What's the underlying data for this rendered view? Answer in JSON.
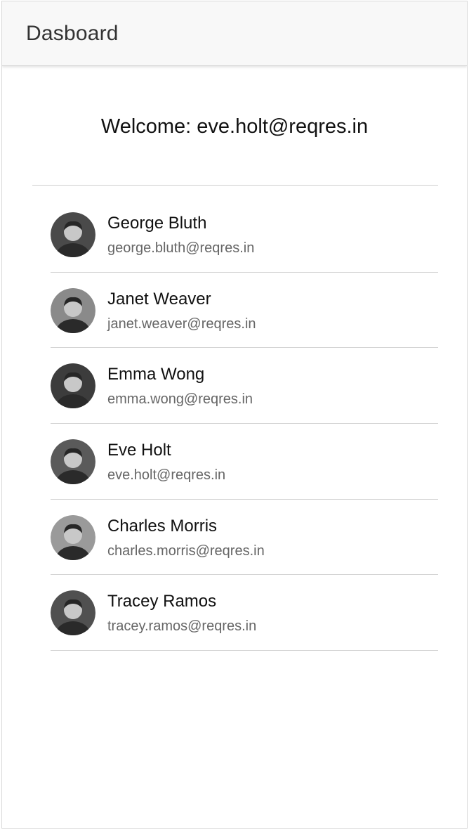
{
  "toolbar": {
    "title": "Dasboard"
  },
  "welcome": {
    "text": "Welcome: eve.holt@reqres.in"
  },
  "users": [
    {
      "name": "George Bluth",
      "email": "george.bluth@reqres.in",
      "avatar_tone": "#4a4a4a"
    },
    {
      "name": "Janet Weaver",
      "email": "janet.weaver@reqres.in",
      "avatar_tone": "#8a8a8a"
    },
    {
      "name": "Emma Wong",
      "email": "emma.wong@reqres.in",
      "avatar_tone": "#3c3c3c"
    },
    {
      "name": "Eve Holt",
      "email": "eve.holt@reqres.in",
      "avatar_tone": "#5a5a5a"
    },
    {
      "name": "Charles Morris",
      "email": "charles.morris@reqres.in",
      "avatar_tone": "#9a9a9a"
    },
    {
      "name": "Tracey Ramos",
      "email": "tracey.ramos@reqres.in",
      "avatar_tone": "#505050"
    }
  ],
  "colors": {
    "toolbar_bg": "#f8f8f8",
    "text_primary": "#111111",
    "text_secondary": "#666666",
    "divider": "#d3d3d3"
  }
}
